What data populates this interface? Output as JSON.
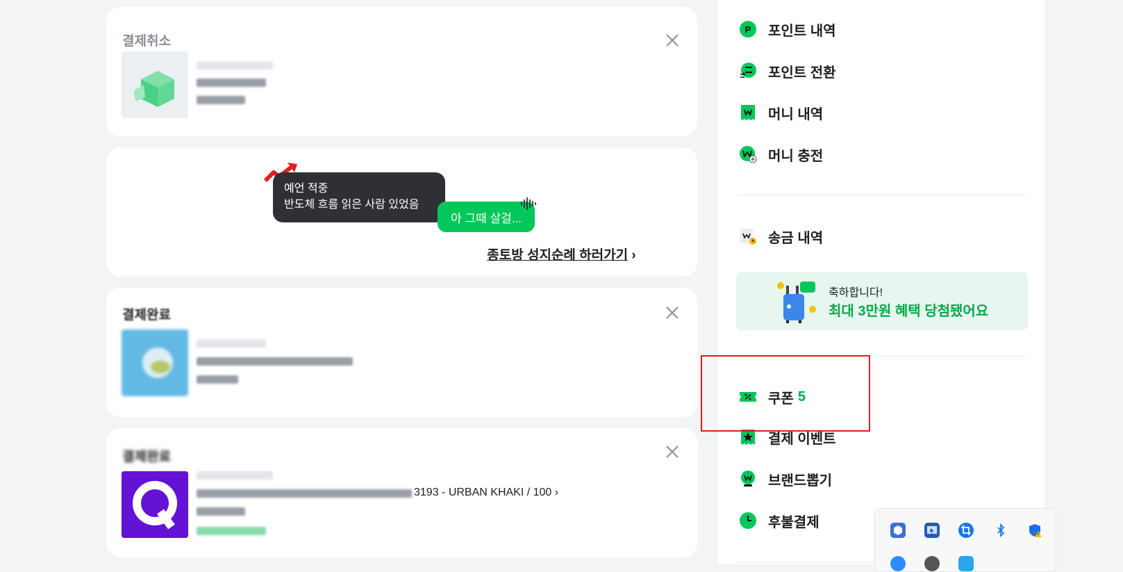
{
  "cards": {
    "cancel": {
      "title": "결제취소"
    },
    "promo": {
      "bubble_line1": "예언 적중",
      "bubble_line2": "반도체 흐름 읽은 사람 있었음",
      "reply": "아 그때 살걸...",
      "link_text": "종토방 성지순례 하러가기",
      "link_arrow": "›"
    },
    "complete": {
      "title": "결제완료"
    },
    "fourth": {
      "title": "결제완료",
      "product_suffix": "3193 - URBAN KHAKI / 100",
      "product_arrow": "›"
    }
  },
  "menu": {
    "point_history": "포인트 내역",
    "point_convert": "포인트 전환",
    "money_history": "머니 내역",
    "money_charge": "머니 충전",
    "transfer_history": "송금 내역",
    "coupon_label": "쿠폰",
    "coupon_count": "5",
    "payment_event": "결제 이벤트",
    "brand_draw": "브랜드뽑기",
    "postpay": "후불결제"
  },
  "banner": {
    "line1": "축하합니다!",
    "line2": "최대 3만원 혜택 당첨됐어요"
  },
  "icons": {
    "point": "P",
    "money": "₩",
    "transfer": "W"
  },
  "colors": {
    "brand_green": "#03c75a",
    "highlight_red": "#e21b1b"
  }
}
